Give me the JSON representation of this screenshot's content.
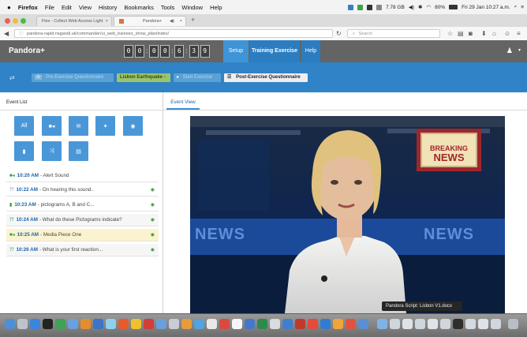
{
  "menubar": {
    "apple": "",
    "app": "Firefox",
    "items": [
      "File",
      "Edit",
      "View",
      "History",
      "Bookmarks",
      "Tools",
      "Window",
      "Help"
    ],
    "network": "7.78 GB",
    "battery": "80%",
    "clock": "Fri 29 Jan 10:27 a.m."
  },
  "browser": {
    "tabs": [
      {
        "label": "Flex - Collect Web Access Light",
        "active": false
      },
      {
        "label": "Pandora+",
        "active": true
      }
    ],
    "url": "pandora-rapid.nsgandi.uk/commander/ui_web_trainees_show_plan/index/",
    "search_placeholder": "Search"
  },
  "app": {
    "brand": "Pandora+",
    "timer": [
      "0",
      "0",
      "0",
      "0",
      "6",
      "3",
      "9"
    ],
    "nav": [
      "Setup",
      "Training Exercise",
      "Help"
    ],
    "workflow": {
      "pre": "Pre-Exercise Questionnaire",
      "lisbon": "Lisbon Earthquake -",
      "start": "Start Exercise",
      "post": "Post-Exercise Questionnaire"
    }
  },
  "left": {
    "title": "Event List",
    "filters": [
      "All",
      "video-icon",
      "email-icon",
      "twitter-icon",
      "web-icon",
      "document-icon",
      "shuffle-icon",
      "news-icon"
    ],
    "events": [
      {
        "time": "10:20 AM",
        "text": "- Alert Sound",
        "icon": "video-icon",
        "eye": false,
        "style": "plain"
      },
      {
        "time": "10:22 AM",
        "text": "- On hearing this sound..",
        "icon": "question-icon",
        "eye": true,
        "style": "plain"
      },
      {
        "time": "10:23 AM",
        "text": "- pictograms A, B and C...",
        "icon": "document-icon",
        "eye": true,
        "style": "plain"
      },
      {
        "time": "10:24 AM",
        "text": "- What do these Pictograms indicate?",
        "icon": "question-icon",
        "eye": true,
        "style": "tint"
      },
      {
        "time": "10:25 AM",
        "text": "- Media Piece One",
        "icon": "video-icon",
        "eye": true,
        "style": "hl"
      },
      {
        "time": "10:26 AM",
        "text": "- What is your first reaction...",
        "icon": "question-icon",
        "eye": true,
        "style": "tint"
      }
    ]
  },
  "right": {
    "tab": "Event View",
    "video": {
      "breaking": "BREAKING",
      "news": "NEWS",
      "banner": "NEWS"
    }
  },
  "tooltip": "Pandora Script: Lisbon V1.docx",
  "colors": {
    "accent": "#2c7dc0",
    "header": "#646464",
    "green": "#9cc46a",
    "highlight": "#fbf3d0"
  }
}
